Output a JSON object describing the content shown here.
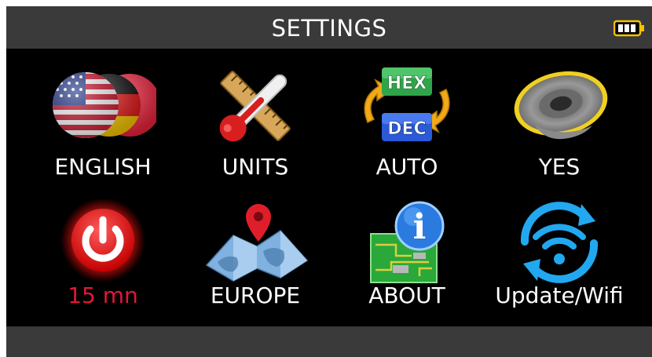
{
  "header": {
    "title": "SETTINGS",
    "battery_icon": "battery-full-icon"
  },
  "tiles": [
    {
      "label": "ENGLISH",
      "icon": "language-flags-icon"
    },
    {
      "label": "UNITS",
      "icon": "units-thermometer-ruler-icon"
    },
    {
      "label": "AUTO",
      "icon": "hex-dec-toggle-icon"
    },
    {
      "label": "YES",
      "icon": "speaker-icon"
    },
    {
      "label": "15 mn",
      "icon": "power-icon",
      "label_color": "#e0173a"
    },
    {
      "label": "EUROPE",
      "icon": "region-map-icon"
    },
    {
      "label": "ABOUT",
      "icon": "info-icon"
    },
    {
      "label": "Update/Wifi",
      "icon": "wifi-update-icon"
    }
  ],
  "icon_text": {
    "hex": "HEX",
    "dec": "DEC",
    "info": "i"
  },
  "colors": {
    "background": "#000000",
    "bar": "#3a3a3a",
    "text": "#ffffff",
    "timeout_text": "#e0173a",
    "battery": "#f2c200"
  }
}
